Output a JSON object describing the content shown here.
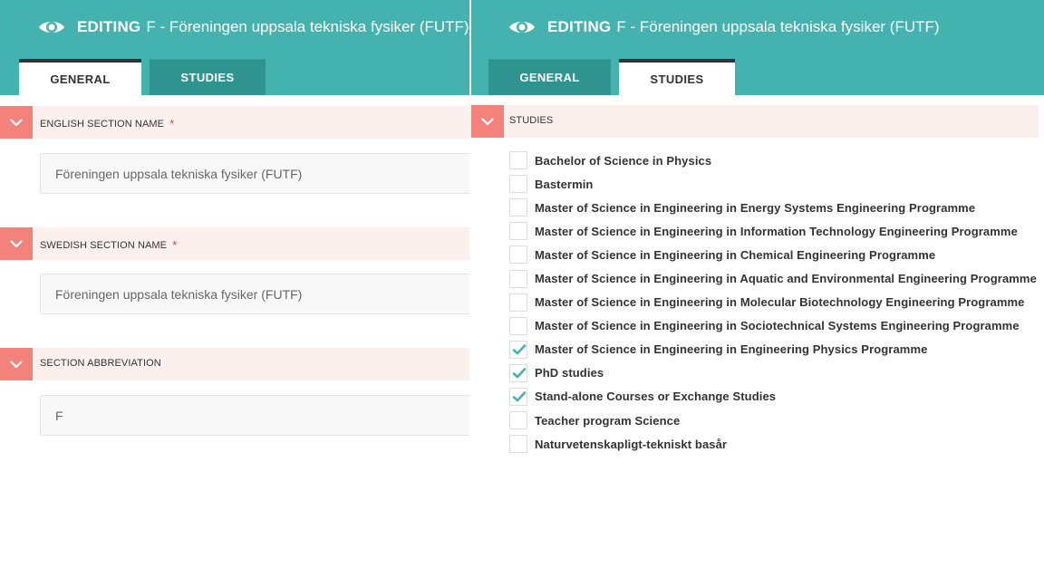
{
  "colors": {
    "header": "#44b3af",
    "tab_inactive": "#2f948f",
    "section_bar": "#fcf0ef",
    "chevron_bg": "#f2827a",
    "required": "#d9463b"
  },
  "left": {
    "title_strong": "EDITING",
    "title_rest": "F - Föreningen uppsala tekniska fysiker (FUTF)",
    "tabs": [
      {
        "label": "GENERAL",
        "active": true
      },
      {
        "label": "STUDIES",
        "active": false
      }
    ],
    "fields": [
      {
        "label": "ENGLISH SECTION NAME",
        "required": "*",
        "value": "Föreningen uppsala tekniska fysiker (FUTF)"
      },
      {
        "label": "SWEDISH SECTION NAME",
        "required": "*",
        "value": "Föreningen uppsala tekniska fysiker (FUTF)"
      },
      {
        "label": "SECTION ABBREVIATION",
        "value": "F"
      }
    ]
  },
  "right": {
    "title_strong": "EDITING",
    "title_rest": "F - Föreningen uppsala tekniska fysiker (FUTF)",
    "tabs": [
      {
        "label": "GENERAL",
        "active": false
      },
      {
        "label": "STUDIES",
        "active": true
      }
    ],
    "section_label": "STUDIES",
    "studies": [
      {
        "label": "Bachelor of Science in Physics",
        "checked": false
      },
      {
        "label": "Bastermin",
        "checked": false
      },
      {
        "label": "Master of Science in Engineering in Energy Systems Engineering Programme",
        "checked": false
      },
      {
        "label": "Master of Science in Engineering in Information Technology Engineering Programme",
        "checked": false
      },
      {
        "label": "Master of Science in Engineering in Chemical Engineering Programme",
        "checked": false
      },
      {
        "label": "Master of Science in Engineering in Aquatic and Environmental Engineering Programme",
        "checked": false
      },
      {
        "label": "Master of Science in Engineering in Molecular Biotechnology Engineering Programme",
        "checked": false
      },
      {
        "label": "Master of Science in Engineering in Sociotechnical Systems Engineering Programme",
        "checked": false
      },
      {
        "label": "Master of Science in Engineering in Engineering Physics Programme",
        "checked": true
      },
      {
        "label": "PhD studies",
        "checked": true
      },
      {
        "label": "Stand-alone Courses or Exchange Studies",
        "checked": true
      },
      {
        "label": "Teacher program Science",
        "checked": false
      },
      {
        "label": "Naturvetenskapligt-tekniskt basår",
        "checked": false
      }
    ]
  }
}
